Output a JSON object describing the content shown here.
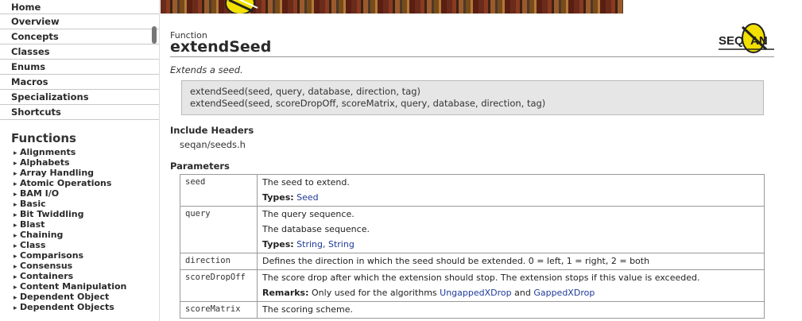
{
  "sidebar": {
    "nav": [
      "Home",
      "Overview",
      "Concepts",
      "Classes",
      "Enums",
      "Macros",
      "Specializations",
      "Shortcuts"
    ],
    "functions_heading": "Functions",
    "function_groups": [
      "Alignments",
      "Alphabets",
      "Array Handling",
      "Atomic Operations",
      "BAM I/O",
      "Basic",
      "Bit Twiddling",
      "Blast",
      "Chaining",
      "Class",
      "Comparisons",
      "Consensus",
      "Containers",
      "Content Manipulation",
      "Dependent Object",
      "Dependent Objects"
    ]
  },
  "banner": {
    "logo_icon": "seqan-small-logo"
  },
  "page": {
    "overline": "Function",
    "title": "extendSeed",
    "logo_text_a": "SEQ",
    "logo_text_b": "AN",
    "brief": "Extends a seed.",
    "signatures": [
      "extendSeed(seed, query, database, direction, tag)",
      "extendSeed(seed, scoreDropOff, scoreMatrix, query, database, direction, tag)"
    ],
    "include_heading": "Include Headers",
    "include_file": "seqan/seeds.h",
    "parameters_heading": "Parameters"
  },
  "params": {
    "seed": {
      "name": "seed",
      "desc": "The seed to extend.",
      "types_label": "Types:",
      "types": "Seed"
    },
    "query": {
      "name": "query",
      "desc": "The query sequence.",
      "desc2": "The database sequence.",
      "types_label": "Types:",
      "types_a": "String",
      "types_sep": ", ",
      "types_b": "String"
    },
    "direction": {
      "name": "direction",
      "desc": "Defines the direction in which the seed should be extended. 0 = left, 1 = right, 2 = both"
    },
    "scoreDropOff": {
      "name": "scoreDropOff",
      "desc": "The score drop after which the extension should stop. The extension stops if this value is exceeded.",
      "remarks_label": "Remarks:",
      "remarks_text": "Only used for the algorithms",
      "link_a": "UngappedXDrop",
      "and_text": "and",
      "link_b": "GappedXDrop"
    },
    "scoreMatrix": {
      "name": "scoreMatrix",
      "desc": "The scoring scheme."
    }
  },
  "colors": {
    "link": "#1f3a99",
    "logo_yellow": "#f2e000",
    "signature_bg": "#e6e6e6"
  }
}
